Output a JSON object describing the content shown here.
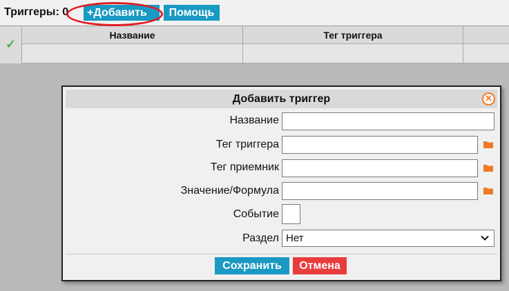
{
  "toolbar": {
    "title": "Триггеры: 0",
    "add_label": "+Добавить",
    "help_label": "Помощь"
  },
  "grid": {
    "columns": [
      "Название",
      "Тег триггера"
    ]
  },
  "dialog": {
    "title": "Добавить триггер",
    "close_icon": "close-icon",
    "fields": {
      "name_label": "Название",
      "name_value": "",
      "trigger_tag_label": "Тег триггера",
      "trigger_tag_value": "",
      "receiver_tag_label": "Тег приемник",
      "receiver_tag_value": "",
      "value_formula_label": "Значение/Формула",
      "value_formula_value": "",
      "event_label": "Событие",
      "section_label": "Раздел",
      "section_value": "Нет"
    },
    "save_label": "Сохранить",
    "cancel_label": "Отмена"
  },
  "colors": {
    "primary": "#1a99c2",
    "danger": "#e83d3d",
    "highlight": "#e01b22",
    "folder": "#f07a28",
    "check": "#4caf50"
  }
}
